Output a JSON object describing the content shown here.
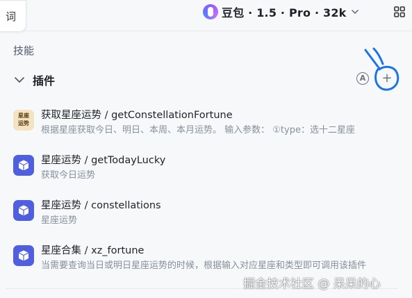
{
  "header": {
    "prompt_tab_text": "词",
    "model_name": "豆包 · 1.5 · Pro · 32k"
  },
  "skills": {
    "section_title": "技能",
    "plugins_label": "插件",
    "auto_icon_text": "A",
    "add_symbol": "+"
  },
  "plugins": [
    {
      "icon": "constellation-badge-icon",
      "icon_text": "星座运势",
      "title": "获取星座运势 / getConstellationFortune",
      "desc": "根据星座获取今日、明日、本周、本月运势。 输入参数： ①type：选十二星座"
    },
    {
      "icon": "cube-icon",
      "title": "星座运势 / getTodayLucky",
      "desc": "获取今日运势"
    },
    {
      "icon": "cube-icon",
      "title": "星座运势 / constellations",
      "desc": "星座运势"
    },
    {
      "icon": "cube-icon",
      "title": "星座合集 / xz_fortune",
      "desc": "当需要查询当日或明日星座运势的时候，根据输入对应星座和类型即可调用该插件"
    }
  ],
  "watermark": "掘金技术社区 @ 呆呆的心",
  "colors": {
    "accent_purple": "#4f5fe0",
    "scribble_blue": "#1a73e8",
    "text_primary": "#1f2329",
    "text_secondary": "#86909c"
  }
}
